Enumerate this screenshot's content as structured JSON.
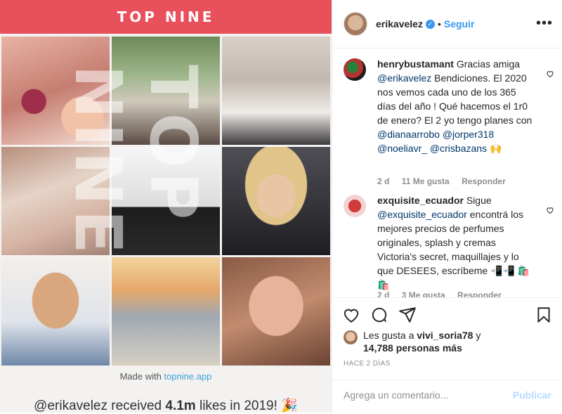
{
  "post_image": {
    "banner_title": "TOP NINE",
    "watermark": "TOP NINE",
    "made_with_prefix": "Made with ",
    "made_with_link": "topnine.app",
    "likes_line_user": "@erikavelez received ",
    "likes_line_count": "4.1m",
    "likes_line_suffix": " likes in 2019! 🎉"
  },
  "header": {
    "username": "erikavelez",
    "verified_icon": "✓",
    "separator": "•",
    "follow_label": "Seguir",
    "more_icon": "•••"
  },
  "comments": [
    {
      "username": "henrybustamant",
      "text_parts": [
        "Gracias amiga ",
        "@erikavelez",
        " Bendiciones. El 2020 nos vemos cada uno de los 365 días del año ! Qué hacemos el 1r0 de enero? El 2 yo tengo planes con ",
        "@dianaarrobo",
        " ",
        "@jorper318",
        " ",
        "@noeliavr_",
        " ",
        "@crisbazans",
        " 🙌"
      ],
      "time": "2 d",
      "likes": "11 Me gusta",
      "reply": "Responder"
    },
    {
      "username": "exquisite_ecuador",
      "text_parts": [
        "Sigue ",
        "@exquisite_ecuador",
        " encontrá los mejores precios de perfumes originales, splash y cremas Victoria's secret, maquillajes y lo que DESEES, escríbeme 📲📲 🛍️🛍️"
      ],
      "time": "2 d",
      "likes": "3 Me gusta",
      "reply": "Responder"
    }
  ],
  "actions": {
    "like_icon": "heart-icon",
    "comment_icon": "comment-icon",
    "share_icon": "share-icon",
    "save_icon": "bookmark-icon"
  },
  "likes_summary": {
    "prefix": "Les gusta a ",
    "user": "vivi_soria78",
    "middle": " y ",
    "count": "14,788 personas más"
  },
  "posted_ago": "HACE 2 DÍAS",
  "comment_box": {
    "placeholder": "Agrega un comentario...",
    "publish_label": "Publicar"
  },
  "colors": {
    "banner": "#e8505b",
    "link_blue": "#3897f0",
    "publish_disabled": "#b3dbff"
  }
}
